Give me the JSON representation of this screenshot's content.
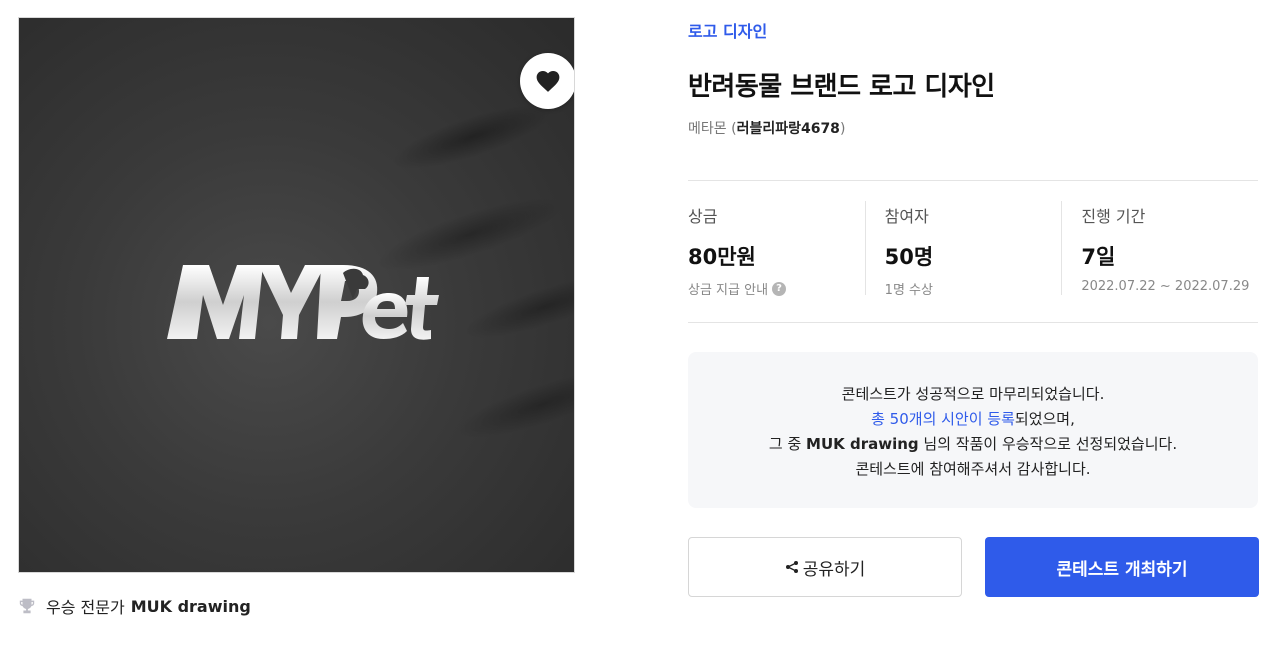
{
  "hero": {
    "logo_text": "MYPet",
    "colors": {
      "background": "#3a3a3a",
      "logo": "#e8e8e8"
    },
    "heart_icon": "heart-icon"
  },
  "winner": {
    "icon": "trophy-icon",
    "prefix": "우승 전문가",
    "name": "MUK drawing"
  },
  "contest": {
    "category": "로고 디자인",
    "title": "반려동물 브랜드 로고 디자인",
    "host_company": "메타몬 (",
    "host_id": "러블리파랑4678",
    "host_suffix": ")"
  },
  "stats": {
    "prize": {
      "label": "상금",
      "value": "80만원",
      "sub": "상금 지급 안내",
      "help_icon": "?"
    },
    "participants": {
      "label": "참여자",
      "value": "50명",
      "sub": "1명 수상"
    },
    "duration": {
      "label": "진행 기간",
      "value": "7일",
      "sub": "2022.07.22 ~ 2022.07.29"
    }
  },
  "notice": {
    "line1": "콘테스트가 성공적으로 마무리되었습니다.",
    "line2_link": "총 50개의 시안이 등록",
    "line2_rest": "되었으며,",
    "line3_prefix": "그 중 ",
    "line3_name": "MUK drawing",
    "line3_rest": " 님의 작품이 우승작으로 선정되었습니다.",
    "line4": "콘테스트에 참여해주셔서 감사합니다."
  },
  "buttons": {
    "share": "공유하기",
    "host": "콘테스트 개최하기"
  },
  "colors": {
    "accent": "#2f5bea"
  }
}
